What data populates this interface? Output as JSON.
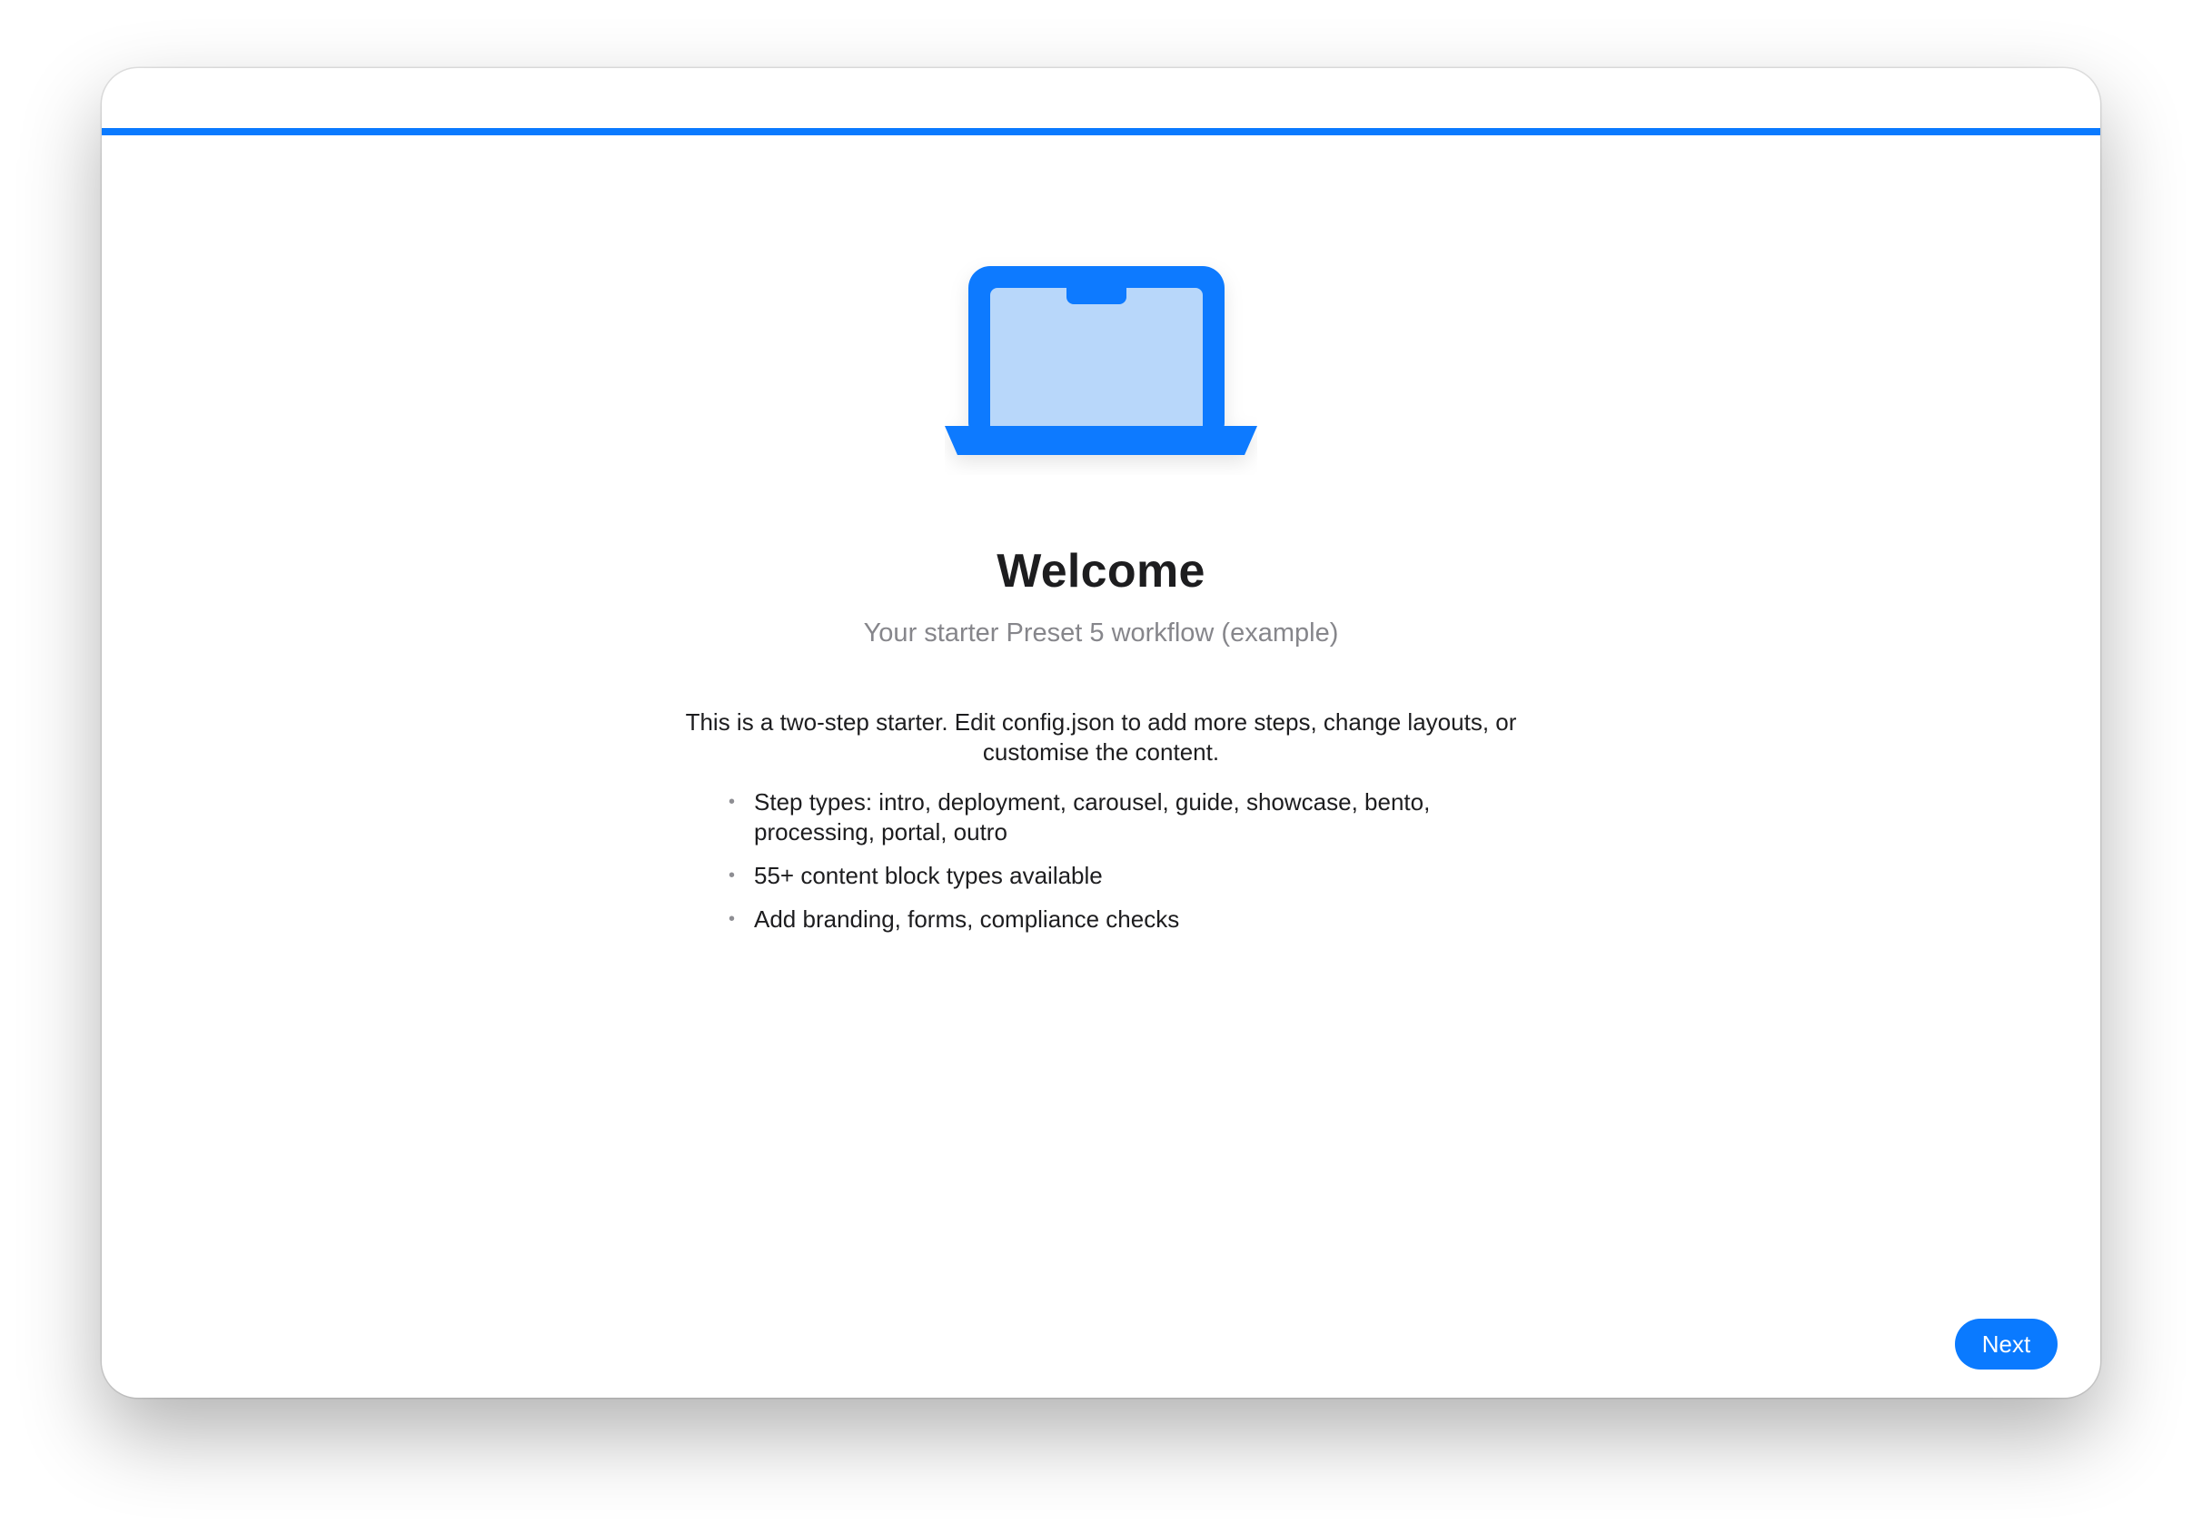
{
  "app": {
    "accent_color": "#0a7aff"
  },
  "progress": {
    "current_step": 1,
    "total_steps": 2,
    "fraction": 1.0
  },
  "hero": {
    "icon": "laptop-icon"
  },
  "content": {
    "title": "Welcome",
    "subtitle": "Your starter Preset 5 workflow (example)",
    "intro": "This is a two-step starter. Edit config.json to add more steps, change layouts, or customise the content.",
    "bullets": [
      "Step types: intro, deployment, carousel, guide, showcase, bento, processing, portal, outro",
      "55+ content block types available",
      "Add branding, forms, compliance checks"
    ],
    "bullet_glyph": "•"
  },
  "footer": {
    "next_label": "Next"
  }
}
